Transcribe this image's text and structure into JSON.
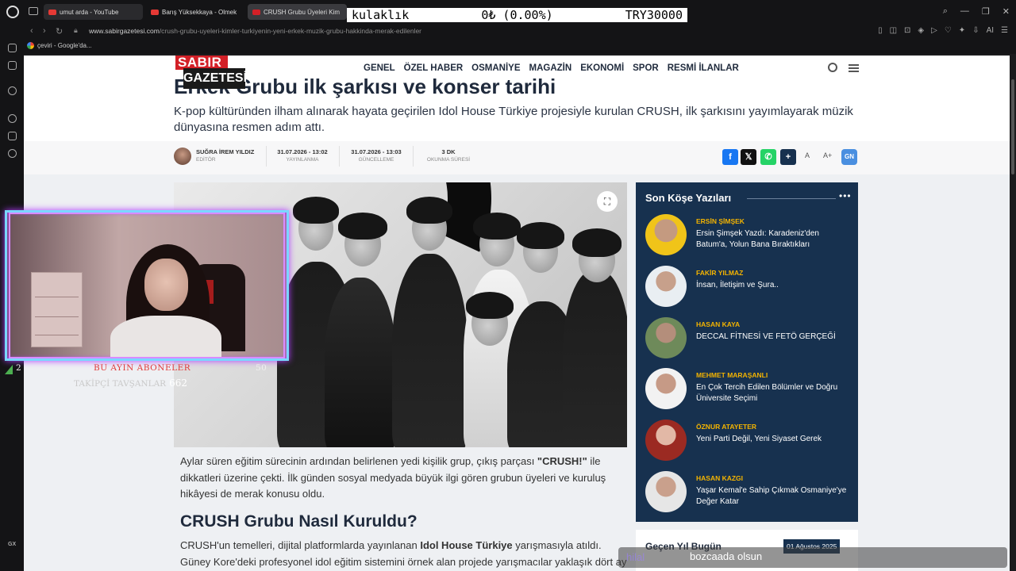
{
  "tabs": [
    {
      "label": "umut arda - YouTube",
      "fav_color": "#e53935"
    },
    {
      "label": "Barış Yüksekkaya - Olmek",
      "fav_color": "#e53935"
    },
    {
      "label": "CRUSH Grubu Üyeleri Kim",
      "fav_color": "#d32027"
    }
  ],
  "stream_banner": {
    "item": "kulaklık",
    "change": "0₺ (0.00%)",
    "goal": "TRY30000"
  },
  "address": {
    "domain": "www.sabirgazetesi.com",
    "path": "/crush-grubu-uyeleri-kimler-turkiyenin-yeni-erkek-muzik-grubu-hakkinda-merak-edilenler"
  },
  "bookmark": {
    "label": "çeviri - Google'da..."
  },
  "sidebar": {
    "gx_label": "GX"
  },
  "site": {
    "logo_top": "SABIR",
    "logo_bottom": "GAZETESİ",
    "menu": [
      "GENEL",
      "ÖZEL HABER",
      "OSMANİYE",
      "MAGAZİN",
      "EKONOMİ",
      "SPOR",
      "RESMİ İLANLAR"
    ]
  },
  "article": {
    "headline_fragment": "Erkek Grubu ilk şarkısı ve konser tarihi",
    "summary": "K-pop kültüründen ilham alınarak hayata geçirilen Idol House Türkiye projesiyle kurulan CRUSH, ilk şarkısını yayımlayarak müzik dünyasına resmen adım attı.",
    "author": {
      "name": "SUĞRA İREM YILDIZ",
      "role": "EDİTÖR"
    },
    "published": {
      "value": "31.07.2026 - 13:02",
      "label": "YAYINLANMA"
    },
    "updated": {
      "value": "31.07.2026 - 13:03",
      "label": "GÜNCELLEME"
    },
    "reading": {
      "value": "3 DK",
      "label": "OKUNMA SÜRESİ"
    },
    "font_small": "A",
    "font_large": "A+",
    "gn_label": "GN",
    "p1_a": "Aylar süren eğitim sürecinin ardından belirlenen yedi kişilik grup, çıkış parçası ",
    "p1_b": "\"CRUSH!\"",
    "p1_c": " ile dikkatleri üzerine çekti. İlk günden sosyal medyada büyük ilgi gören grubun üyeleri ve kuruluş hikâyesi de merak konusu oldu.",
    "subheading": "CRUSH Grubu Nasıl Kuruldu?",
    "p2_a": "CRUSH'un temelleri, dijital platformlarda yayınlanan ",
    "p2_b": "Idol House Türkiye",
    "p2_c": " yarışmasıyla atıldı. Güney Kore'deki profesyonel idol eğitim sistemini örnek alan projede yarışmacılar yaklaşık dört ay"
  },
  "panel": {
    "title": "Son Köşe Yazıları",
    "more": "•••",
    "writers": [
      {
        "name": "ERSİN ŞİMŞEK",
        "title": "Ersin Şimşek Yazdı: Karadeniz'den Batum'a, Yolun Bana Bıraktıkları"
      },
      {
        "name": "FAKİR YILMAZ",
        "title": "İnsan, İletişim ve Şura.."
      },
      {
        "name": "HASAN KAYA",
        "title": "DECCAL FİTNESİ VE FETÖ GERÇEĞİ"
      },
      {
        "name": "MEHMET MARAŞANLI",
        "title": "En Çok Tercih Edilen Bölümler ve Doğru Üniversite Seçimi"
      },
      {
        "name": "ÖZNUR ATAYETER",
        "title": "Yeni Parti Değil, Yeni Siyaset Gerek"
      },
      {
        "name": "HASAN KAZGI",
        "title": "Yaşar Kemal'e Sahip Çıkmak Osmaniye'ye Değer Katar"
      }
    ]
  },
  "gecen": {
    "title": "Geçen Yıl Bugün",
    "date": "01 Ağustos 2025"
  },
  "overlay": {
    "sub_count_left": "2",
    "sub_label": "BU AYIN ABONELER",
    "sub_count_right": "50",
    "follow_label": "TAKİPÇİ TAVŞANLAR",
    "follow_count": "662"
  },
  "chat": {
    "user": "hilal",
    "message": "bozcaada olsun"
  }
}
